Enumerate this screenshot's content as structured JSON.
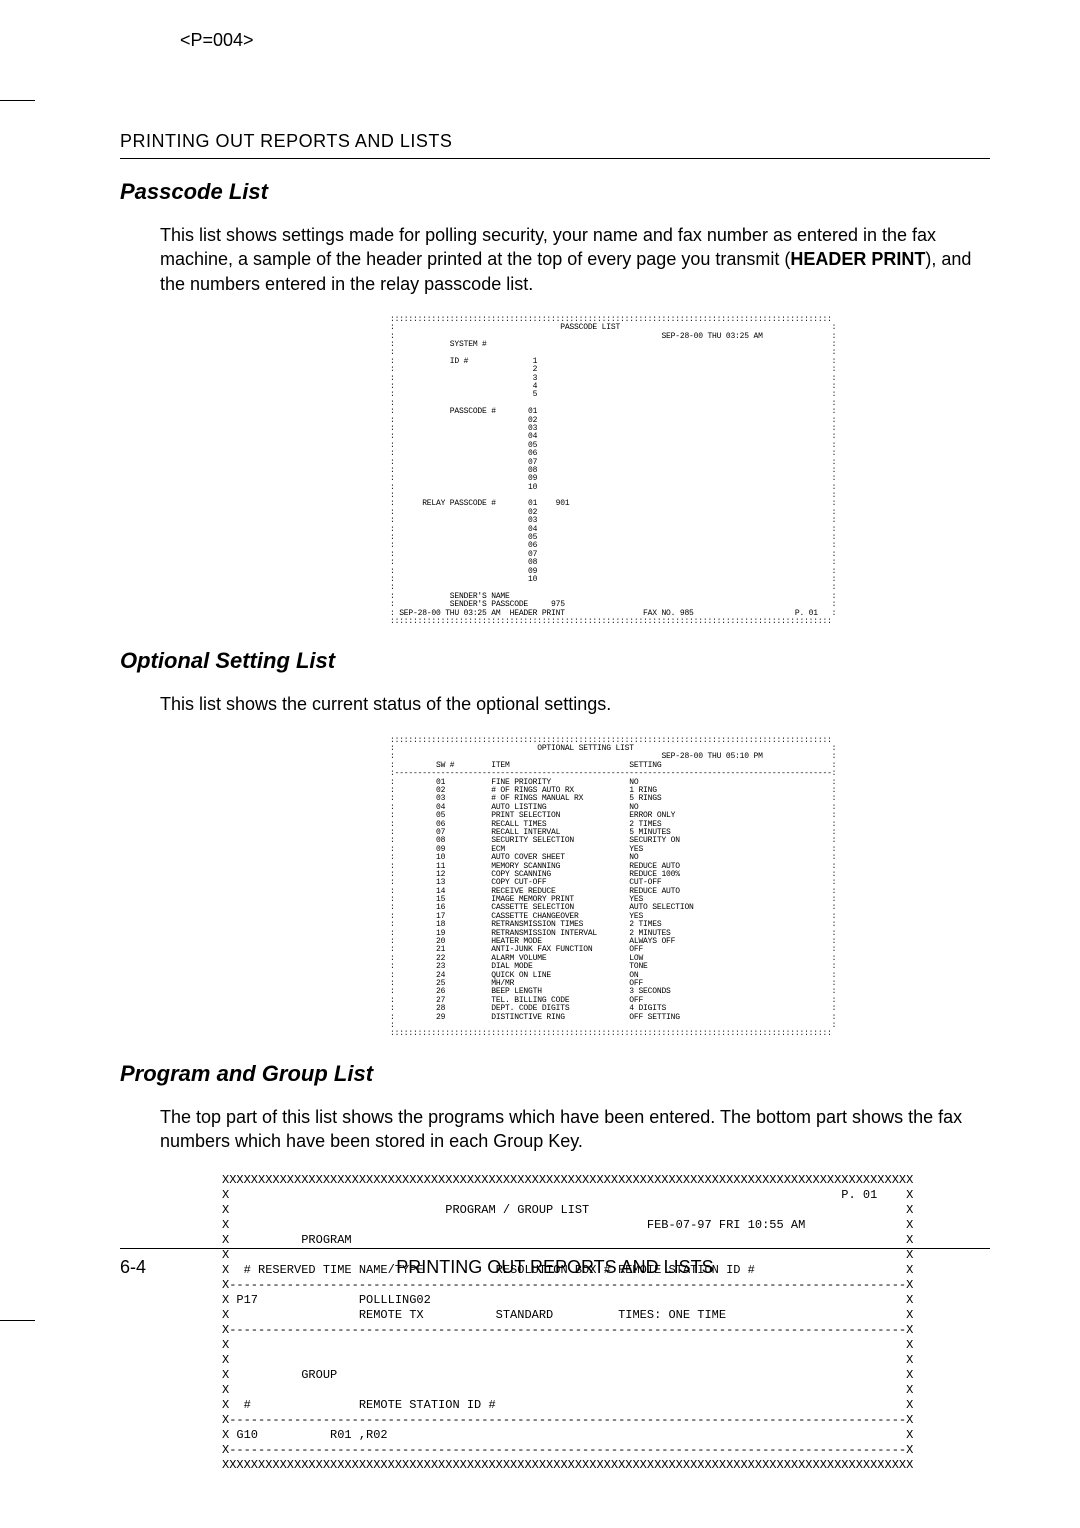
{
  "page_marker": "<P=004>",
  "running_head": "PRINTING OUT REPORTS AND LISTS",
  "sections": {
    "passcode": {
      "title": "Passcode List",
      "para_pre": "This list shows settings made for polling security, your name and fax number as entered in the fax machine, a sample of the header printed at the top of every page you transmit (",
      "para_bold": "HEADER PRINT",
      "para_post": "), and the numbers entered in the relay passcode list."
    },
    "optional": {
      "title": "Optional Setting List",
      "para": "This list shows the current status of the optional settings."
    },
    "program_group": {
      "title": "Program and Group List",
      "para": "The top part of this list shows the programs which have been entered. The bottom part shows the fax numbers which have been stored in each Group Key."
    }
  },
  "printouts": {
    "passcode_list": "::::::::::::::::::::::::::::::::::::::::::::::::::::::::::::::::::::::::::::::::::::::::::::::::\n:                                    PASSCODE LIST                                              :\n:                                                          SEP-28-00 THU 03:25 AM               :\n:            SYSTEM #                                                                           :\n:                                                                                               :\n:            ID #              1                                                                :\n:                              2                                                                :\n:                              3                                                                :\n:                              4                                                                :\n:                              5                                                                :\n:                                                                                               :\n:            PASSCODE #       01                                                                :\n:                             02                                                                :\n:                             03                                                                :\n:                             04                                                                :\n:                             05                                                                :\n:                             06                                                                :\n:                             07                                                                :\n:                             08                                                                :\n:                             09                                                                :\n:                             10                                                                :\n:                                                                                               :\n:      RELAY PASSCODE #       01    901                                                         :\n:                             02                                                                :\n:                             03                                                                :\n:                             04                                                                :\n:                             05                                                                :\n:                             06                                                                :\n:                             07                                                                :\n:                             08                                                                :\n:                             09                                                                :\n:                             10                                                                :\n:                                                                                               :\n:            SENDER'S NAME                                                                      :\n:            SENDER'S PASSCODE     975                                                          :\n: SEP-28-00 THU 03:25 AM  HEADER PRINT                 FAX NO. 985                      P. 01   :\n::::::::::::::::::::::::::::::::::::::::::::::::::::::::::::::::::::::::::::::::::::::::::::::::",
    "optional_list": "::::::::::::::::::::::::::::::::::::::::::::::::::::::::::::::::::::::::::::::::::::::::::::::::\n:                               OPTIONAL SETTING LIST                                           :\n:                                                          SEP-28-00 THU 05:10 PM               :\n:         SW #        ITEM                          SETTING                                     :\n:-----------------------------------------------------------------------------------------------:\n:         01          FINE PRIORITY                 NO                                          :\n:         02          # OF RINGS AUTO RX            1 RING                                      :\n:         03          # OF RINGS MANUAL RX          5 RINGS                                     :\n:         04          AUTO LISTING                  NO                                          :\n:         05          PRINT SELECTION               ERROR ONLY                                  :\n:         06          RECALL TIMES                  2 TIMES                                     :\n:         07          RECALL INTERVAL               5 MINUTES                                   :\n:         08          SECURITY SELECTION            SECURITY ON                                 :\n:         09          ECM                           YES                                         :\n:         10          AUTO COVER SHEET              NO                                          :\n:         11          MEMORY SCANNING               REDUCE AUTO                                 :\n:         12          COPY SCANNING                 REDUCE 100%                                 :\n:         13          COPY CUT-OFF                  CUT-OFF                                     :\n:         14          RECEIVE REDUCE                REDUCE AUTO                                 :\n:         15          IMAGE MEMORY PRINT            YES                                         :\n:         16          CASSETTE SELECTION            AUTO SELECTION                              :\n:         17          CASSETTE CHANGEOVER           YES                                         :\n:         18          RETRANSMISSION TIMES          2 TIMES                                     :\n:         19          RETRANSMISSION INTERVAL       2 MINUTES                                   :\n:         20          HEATER MODE                   ALWAYS OFF                                  :\n:         21          ANTI-JUNK FAX FUNCTION        OFF                                         :\n:         22          ALARM VOLUME                  LOW                                         :\n:         23          DIAL MODE                     TONE                                        :\n:         24          QUICK ON LINE                 ON                                          :\n:         25          MH/MR                         OFF                                         :\n:         26          BEEP LENGTH                   3 SECONDS                                   :\n:         27          TEL. BILLING CODE             OFF                                         :\n:         28          DEPT. CODE DIGITS             4 DIGITS                                    :\n:         29          DISTINCTIVE RING              OFF SETTING                                 :\n:                                                                                               :\n::::::::::::::::::::::::::::::::::::::::::::::::::::::::::::::::::::::::::::::::::::::::::::::::",
    "program_group_list": "XXXXXXXXXXXXXXXXXXXXXXXXXXXXXXXXXXXXXXXXXXXXXXXXXXXXXXXXXXXXXXXXXXXXXXXXXXXXXXXXXXXXXXXXXXXXXXXX\nX                                                                                     P. 01    X\nX                              PROGRAM / GROUP LIST                                            X\nX                                                          FEB-07-97 FRI 10:55 AM              X\nX          PROGRAM                                                                             X\nX                                                                                              X\nX  # RESERVED TIME NAME/TYPE          RESOLUTION BOX # REMOTE STATION ID #                     X\nX----------------------------------------------------------------------------------------------X\nX P17              POLLLING02                                                                  X\nX                  REMOTE TX          STANDARD         TIMES: ONE TIME                         X\nX----------------------------------------------------------------------------------------------X\nX                                                                                              X\nX                                                                                              X\nX          GROUP                                                                               X\nX                                                                                              X\nX  #               REMOTE STATION ID #                                                         X\nX----------------------------------------------------------------------------------------------X\nX G10          R01 ,R02                                                                        X\nX----------------------------------------------------------------------------------------------X\nXXXXXXXXXXXXXXXXXXXXXXXXXXXXXXXXXXXXXXXXXXXXXXXXXXXXXXXXXXXXXXXXXXXXXXXXXXXXXXXXXXXXXXXXXXXXXXXX"
  },
  "footer": {
    "page_number": "6-4",
    "title": "PRINTING OUT REPORTS AND LISTS"
  }
}
